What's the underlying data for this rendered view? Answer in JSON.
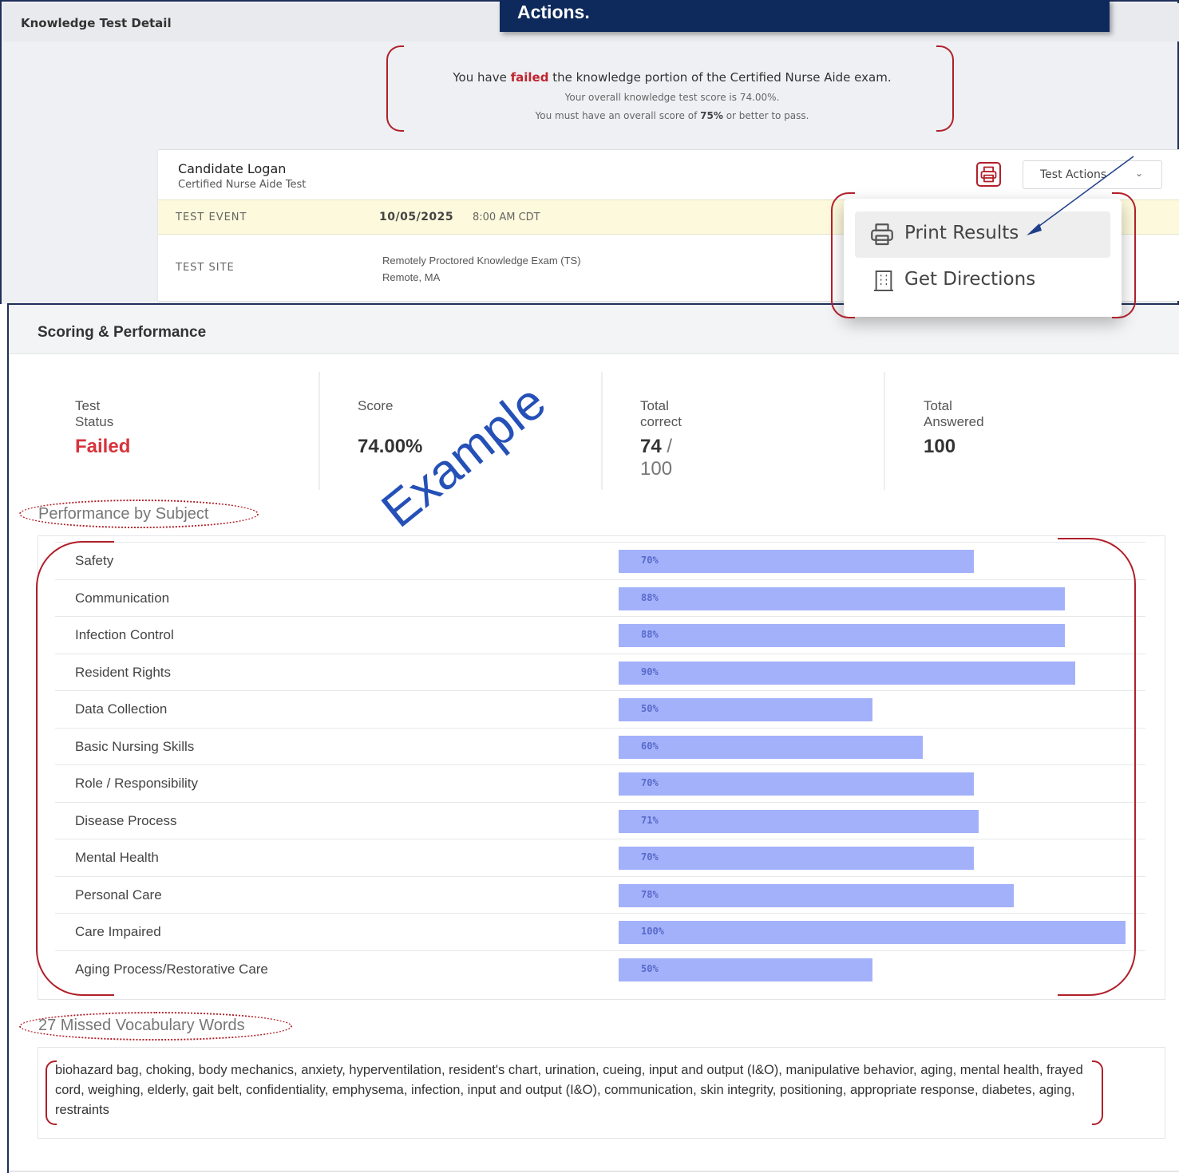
{
  "header": {
    "title": "Knowledge Test Detail",
    "callout": "Actions."
  },
  "result_message": {
    "line1_prefix": "You have ",
    "line1_status": "failed",
    "line1_suffix": " the knowledge portion of the Certified Nurse Aide exam.",
    "line2": "Your overall knowledge test score is 74.00%.",
    "line3_prefix": "You must have an overall score of ",
    "line3_threshold": "75%",
    "line3_suffix": " or better to pass."
  },
  "candidate": {
    "name": "Candidate Logan",
    "test": "Certified Nurse Aide Test"
  },
  "test_actions": {
    "label": "Test Actions",
    "menu": [
      "Print Results",
      "Get Directions"
    ]
  },
  "test_event": {
    "label": "TEST EVENT",
    "date": "10/05/2025",
    "time": "8:00 AM CDT"
  },
  "test_site": {
    "label": "TEST SITE",
    "name": "Remotely Proctored Knowledge Exam (TS)",
    "location": "Remote, MA"
  },
  "scoring": {
    "title": "Scoring & Performance",
    "stats": [
      {
        "label": "Test Status",
        "value": "Failed"
      },
      {
        "label": "Score",
        "value": "74.00%"
      },
      {
        "label": "Total correct",
        "value": "74",
        "sub": " / 100"
      },
      {
        "label": "Total Answered",
        "value": "100"
      }
    ]
  },
  "performance": {
    "title": "Performance by Subject",
    "watermark": "Example",
    "status_color": "#d7343c",
    "bar_color": "#a3b1fa"
  },
  "chart_data": {
    "type": "bar",
    "categories": [
      "Safety",
      "Communication",
      "Infection Control",
      "Resident Rights",
      "Data Collection",
      "Basic Nursing Skills",
      "Role / Responsibility",
      "Disease Process",
      "Mental Health",
      "Personal Care",
      "Care Impaired",
      "Aging Process/Restorative Care"
    ],
    "values": [
      70,
      88,
      88,
      90,
      50,
      60,
      70,
      71,
      70,
      78,
      100,
      50
    ],
    "labels": [
      "70%",
      "88%",
      "88%",
      "90%",
      "50%",
      "60%",
      "70%",
      "71%",
      "70%",
      "78%",
      "100%",
      "50%"
    ],
    "xlim": [
      0,
      100
    ]
  },
  "vocabulary": {
    "title": "27 Missed Vocabulary Words",
    "words": "biohazard bag, choking, body mechanics, anxiety, hyperventilation, resident's chart, urination, cueing, input and output (I&O), manipulative behavior, aging, mental health, frayed cord, weighing, elderly, gait belt, confidentiality, emphysema, infection, input and output (I&O), communication, skin integrity, positioning, appropriate response, diabetes, aging, restraints"
  },
  "icons": {
    "printer": "printer-icon",
    "building": "building-icon",
    "chevron": "chevron-down-icon"
  }
}
